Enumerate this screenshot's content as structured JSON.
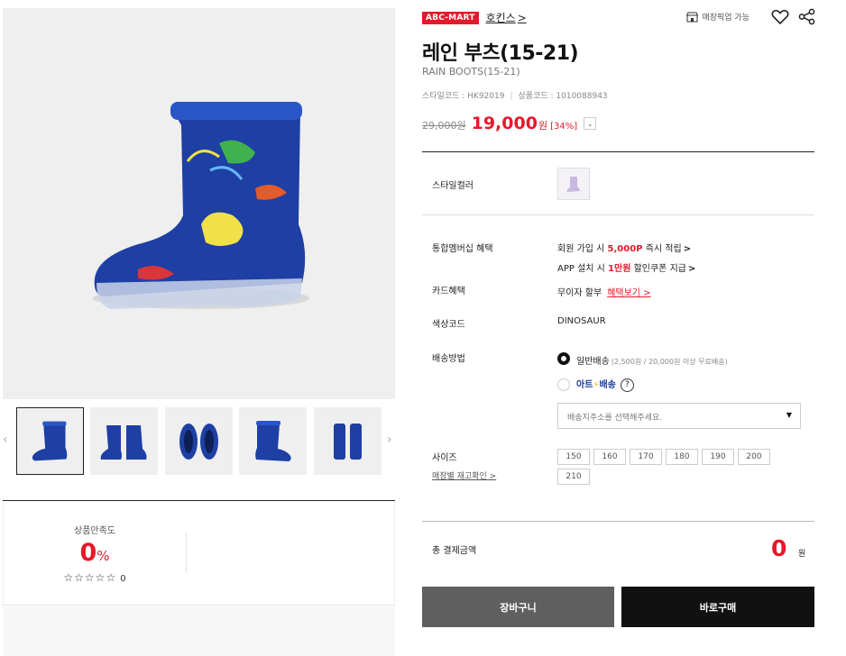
{
  "brand": {
    "badge": "ABC-MART",
    "link": "호킨스",
    "chevron": ">"
  },
  "top_actions": {
    "pickup_label": "매장픽업 가능"
  },
  "product": {
    "title": "레인 부츠(15-21)",
    "subtitle": "RAIN BOOTS(15-21)",
    "style_code_text": "스타일코드 : HK92019",
    "product_code_text": "상품코드 : 1010088943",
    "original_price": "29,000원",
    "sale_price": "19,000",
    "currency": "원",
    "discount": "[34%]",
    "price_toggle": "⌄"
  },
  "info": {
    "style_color_label": "스타일컬러",
    "membership_label": "통합멤버십 혜택",
    "membership_line1": {
      "prefix": "회원 가입 시 ",
      "highlight": "5,000P",
      "suffix": " 즉시 적립"
    },
    "membership_line2": {
      "prefix": "APP 설치 시 ",
      "highlight": "1만원",
      "suffix": " 할인쿠폰 지급"
    },
    "card_label": "카드혜택",
    "card_text": "무이자 할부",
    "card_link": "혜택보기 >",
    "color_code_label": "색상코드",
    "color_code_value": "DINOSAUR",
    "shipping_label": "배송방법",
    "shipping_normal": "일반배송",
    "shipping_normal_note": "(2,500원 / 20,000원 이상 무료배송)",
    "shipping_art_prefix": "아트",
    "shipping_art_suffix": "배송",
    "help": "?",
    "address_placeholder": "배송지주소를 선택해주세요.",
    "size_label": "사이즈",
    "store_stock_link": "매장별 재고확인 >",
    "sizes": [
      "150",
      "160",
      "170",
      "180",
      "190",
      "200",
      "210"
    ],
    "arrow": ">"
  },
  "total": {
    "label": "총 결제금액",
    "amount": "0",
    "unit": "원"
  },
  "buttons": {
    "cart": "장바구니",
    "buy": "바로구매"
  },
  "review": {
    "label": "상품만족도",
    "percent": "0",
    "percent_unit": "%",
    "stars": "☆☆☆☆☆",
    "count": "0"
  },
  "thumbnails": {
    "prev": "‹",
    "next": "›",
    "count": 5,
    "selected_index": 0
  },
  "colors": {
    "accent": "#e4192b",
    "boot_blue": "#1e3fa3",
    "dark": "#111111"
  }
}
